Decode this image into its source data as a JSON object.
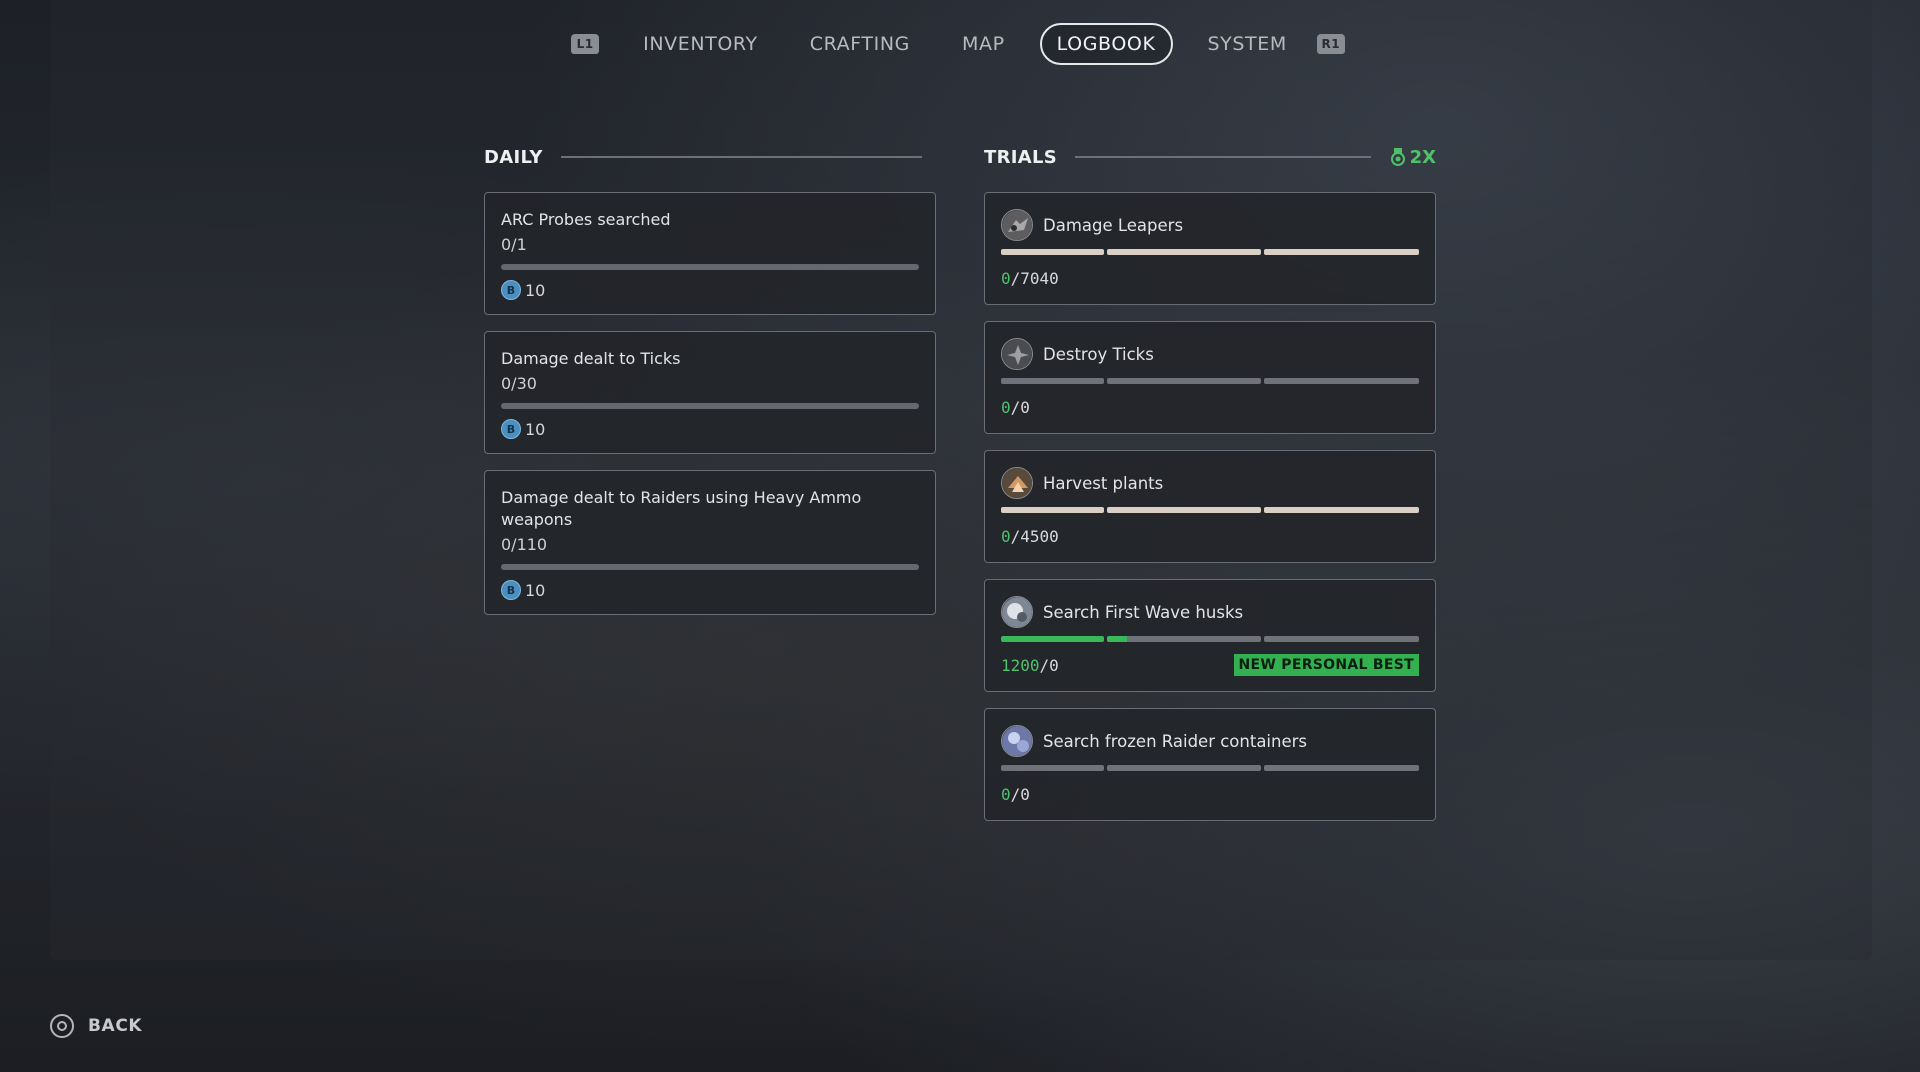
{
  "nav": {
    "left_button": "L1",
    "right_button": "R1",
    "tabs": [
      {
        "label": "INVENTORY",
        "active": false
      },
      {
        "label": "CRAFTING",
        "active": false
      },
      {
        "label": "MAP",
        "active": false
      },
      {
        "label": "LOGBOOK",
        "active": true
      },
      {
        "label": "SYSTEM",
        "active": false
      }
    ]
  },
  "daily": {
    "title": "DAILY",
    "items": [
      {
        "title": "ARC Probes searched",
        "progress": "0/1",
        "progress_fraction": 0,
        "reward": "10",
        "reward_icon": "coin-icon"
      },
      {
        "title": "Damage dealt to Ticks",
        "progress": "0/30",
        "progress_fraction": 0,
        "reward": "10",
        "reward_icon": "coin-icon"
      },
      {
        "title": "Damage dealt to Raiders using Heavy Ammo weapons",
        "progress": "0/110",
        "progress_fraction": 0,
        "reward": "10",
        "reward_icon": "coin-icon"
      }
    ]
  },
  "trials": {
    "title": "TRIALS",
    "multiplier": "2X",
    "multiplier_color": "#4fc16a",
    "items": [
      {
        "name": "Damage Leapers",
        "current": "0",
        "target": "7040",
        "icon": "leaper-icon",
        "bar_style": "light",
        "fill_fraction": 0,
        "badge": ""
      },
      {
        "name": "Destroy Ticks",
        "current": "0",
        "target": "0",
        "icon": "tick-icon",
        "bar_style": "dark",
        "fill_fraction": 0,
        "badge": ""
      },
      {
        "name": "Harvest plants",
        "current": "0",
        "target": "4500",
        "icon": "plant-icon",
        "bar_style": "light",
        "fill_fraction": 0,
        "badge": ""
      },
      {
        "name": "Search First Wave husks",
        "current": "1200",
        "target": "0",
        "icon": "husk-icon",
        "bar_style": "dark",
        "fill_fraction": 0.25,
        "badge": "NEW PERSONAL BEST"
      },
      {
        "name": "Search frozen Raider containers",
        "current": "0",
        "target": "0",
        "icon": "container-icon",
        "bar_style": "dark",
        "fill_fraction": 0,
        "badge": ""
      }
    ]
  },
  "footer": {
    "back_label": "BACK"
  },
  "colors": {
    "accent_green": "#4fc16a",
    "badge_green": "#33b04f",
    "coin_blue": "#4a8fc0"
  }
}
